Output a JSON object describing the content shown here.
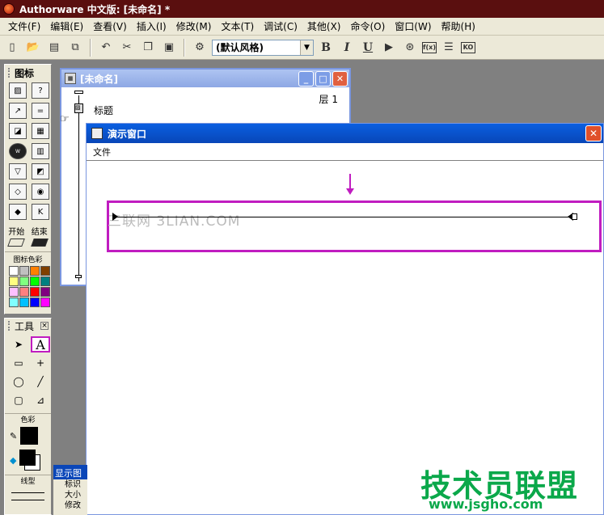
{
  "app": {
    "title": "Authorware 中文版: [未命名] *"
  },
  "menu": [
    "文件(F)",
    "编辑(E)",
    "查看(V)",
    "插入(I)",
    "修改(M)",
    "文本(T)",
    "调试(C)",
    "其他(X)",
    "命令(O)",
    "窗口(W)",
    "帮助(H)"
  ],
  "toolbar": {
    "style_value": "(默认风格)",
    "bold": "B",
    "italic": "I",
    "underline": "U",
    "fn_label": "f(x)",
    "ko_label": "KO"
  },
  "icons_palette": {
    "title": "图标",
    "start_label": "开始",
    "end_label": "结束",
    "colors_label": "图标色彩",
    "swatches": [
      "#ffffff",
      "#c0c0c0",
      "#ff8000",
      "#804000",
      "#ffff80",
      "#80ff80",
      "#00ff00",
      "#008080",
      "#ffc0ff",
      "#ff8080",
      "#ff0000",
      "#800080",
      "#80ffff",
      "#00c0ff",
      "#0000ff",
      "#ff00ff"
    ]
  },
  "tools_palette": {
    "title": "工具",
    "text_tool": "A",
    "color_label": "色彩",
    "line_label": "线型"
  },
  "flow_window": {
    "title": "[未命名]",
    "layer": "层 1",
    "icon_label": "标题"
  },
  "presentation_window": {
    "title": "演示窗口",
    "menu_file": "文件"
  },
  "watermark": "三联网 3LIAN.COM",
  "props_panel": {
    "title": "显示图",
    "labels": [
      "标识",
      "大小",
      "修改"
    ]
  },
  "brand": {
    "name": "技术员联盟",
    "url": "www.jsgho.com"
  }
}
